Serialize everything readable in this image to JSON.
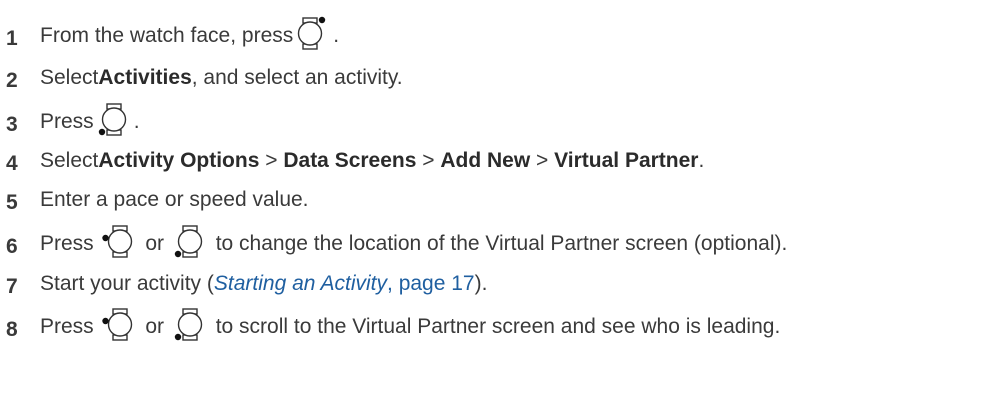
{
  "steps": [
    {
      "number": "1",
      "parts": {
        "a": "From the watch face, press ",
        "b": "."
      },
      "icon": "watch-top-right-button-icon"
    },
    {
      "number": "2",
      "parts": {
        "a": "Select ",
        "b": "Activities",
        "c": ", and select an activity."
      }
    },
    {
      "number": "3",
      "parts": {
        "a": "Press ",
        "b": "."
      },
      "icon": "watch-bottom-left-button-icon"
    },
    {
      "number": "4",
      "parts": {
        "a": "Select ",
        "b": "Activity Options",
        "c": " > ",
        "d": "Data Screens",
        "e": " > ",
        "f": "Add New",
        "g": " > ",
        "h": "Virtual Partner",
        "i": "."
      }
    },
    {
      "number": "5",
      "parts": {
        "a": "Enter a pace or speed value."
      }
    },
    {
      "number": "6",
      "parts": {
        "a": "Press ",
        "b": " or ",
        "c": " to change the location of the Virtual Partner screen (optional)."
      },
      "icons": [
        "watch-middle-left-button-icon",
        "watch-bottom-left-button-icon"
      ]
    },
    {
      "number": "7",
      "parts": {
        "a": "Start your activity (",
        "link": "Starting an Activity",
        "link_page": ", page 17",
        "b": ")."
      }
    },
    {
      "number": "8",
      "parts": {
        "a": "Press ",
        "b": " or ",
        "c": " to scroll to the Virtual Partner screen and see who is leading."
      },
      "icons": [
        "watch-middle-left-button-icon",
        "watch-bottom-left-button-icon"
      ]
    }
  ],
  "colors": {
    "text": "#3a3a3a",
    "link": "#1f5fa0"
  }
}
